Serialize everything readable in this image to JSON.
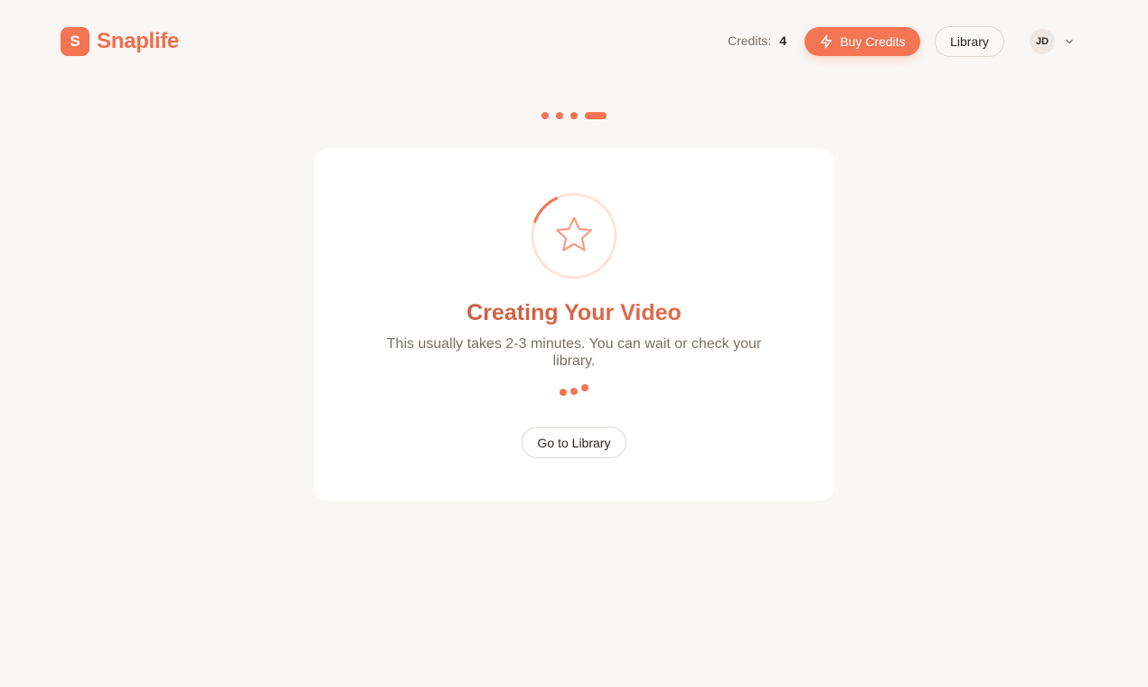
{
  "app": {
    "logo_letter": "S",
    "name": "Snaplife"
  },
  "header": {
    "credits_label": "Credits:",
    "credits_value": "4",
    "buy_credits_label": "Buy Credits",
    "library_label": "Library",
    "avatar_initials": "JD"
  },
  "stepper": {
    "total_steps": 4,
    "current_step": 4
  },
  "status_card": {
    "icon": "star-icon",
    "title": "Creating Your Video",
    "description": "This usually takes 2-3 minutes. You can wait or check your library.",
    "action_label": "Go to Library"
  },
  "colors": {
    "accent": "#f37553",
    "accent_light": "#fde3da",
    "background": "#f9f7f5",
    "card": "#ffffff"
  }
}
